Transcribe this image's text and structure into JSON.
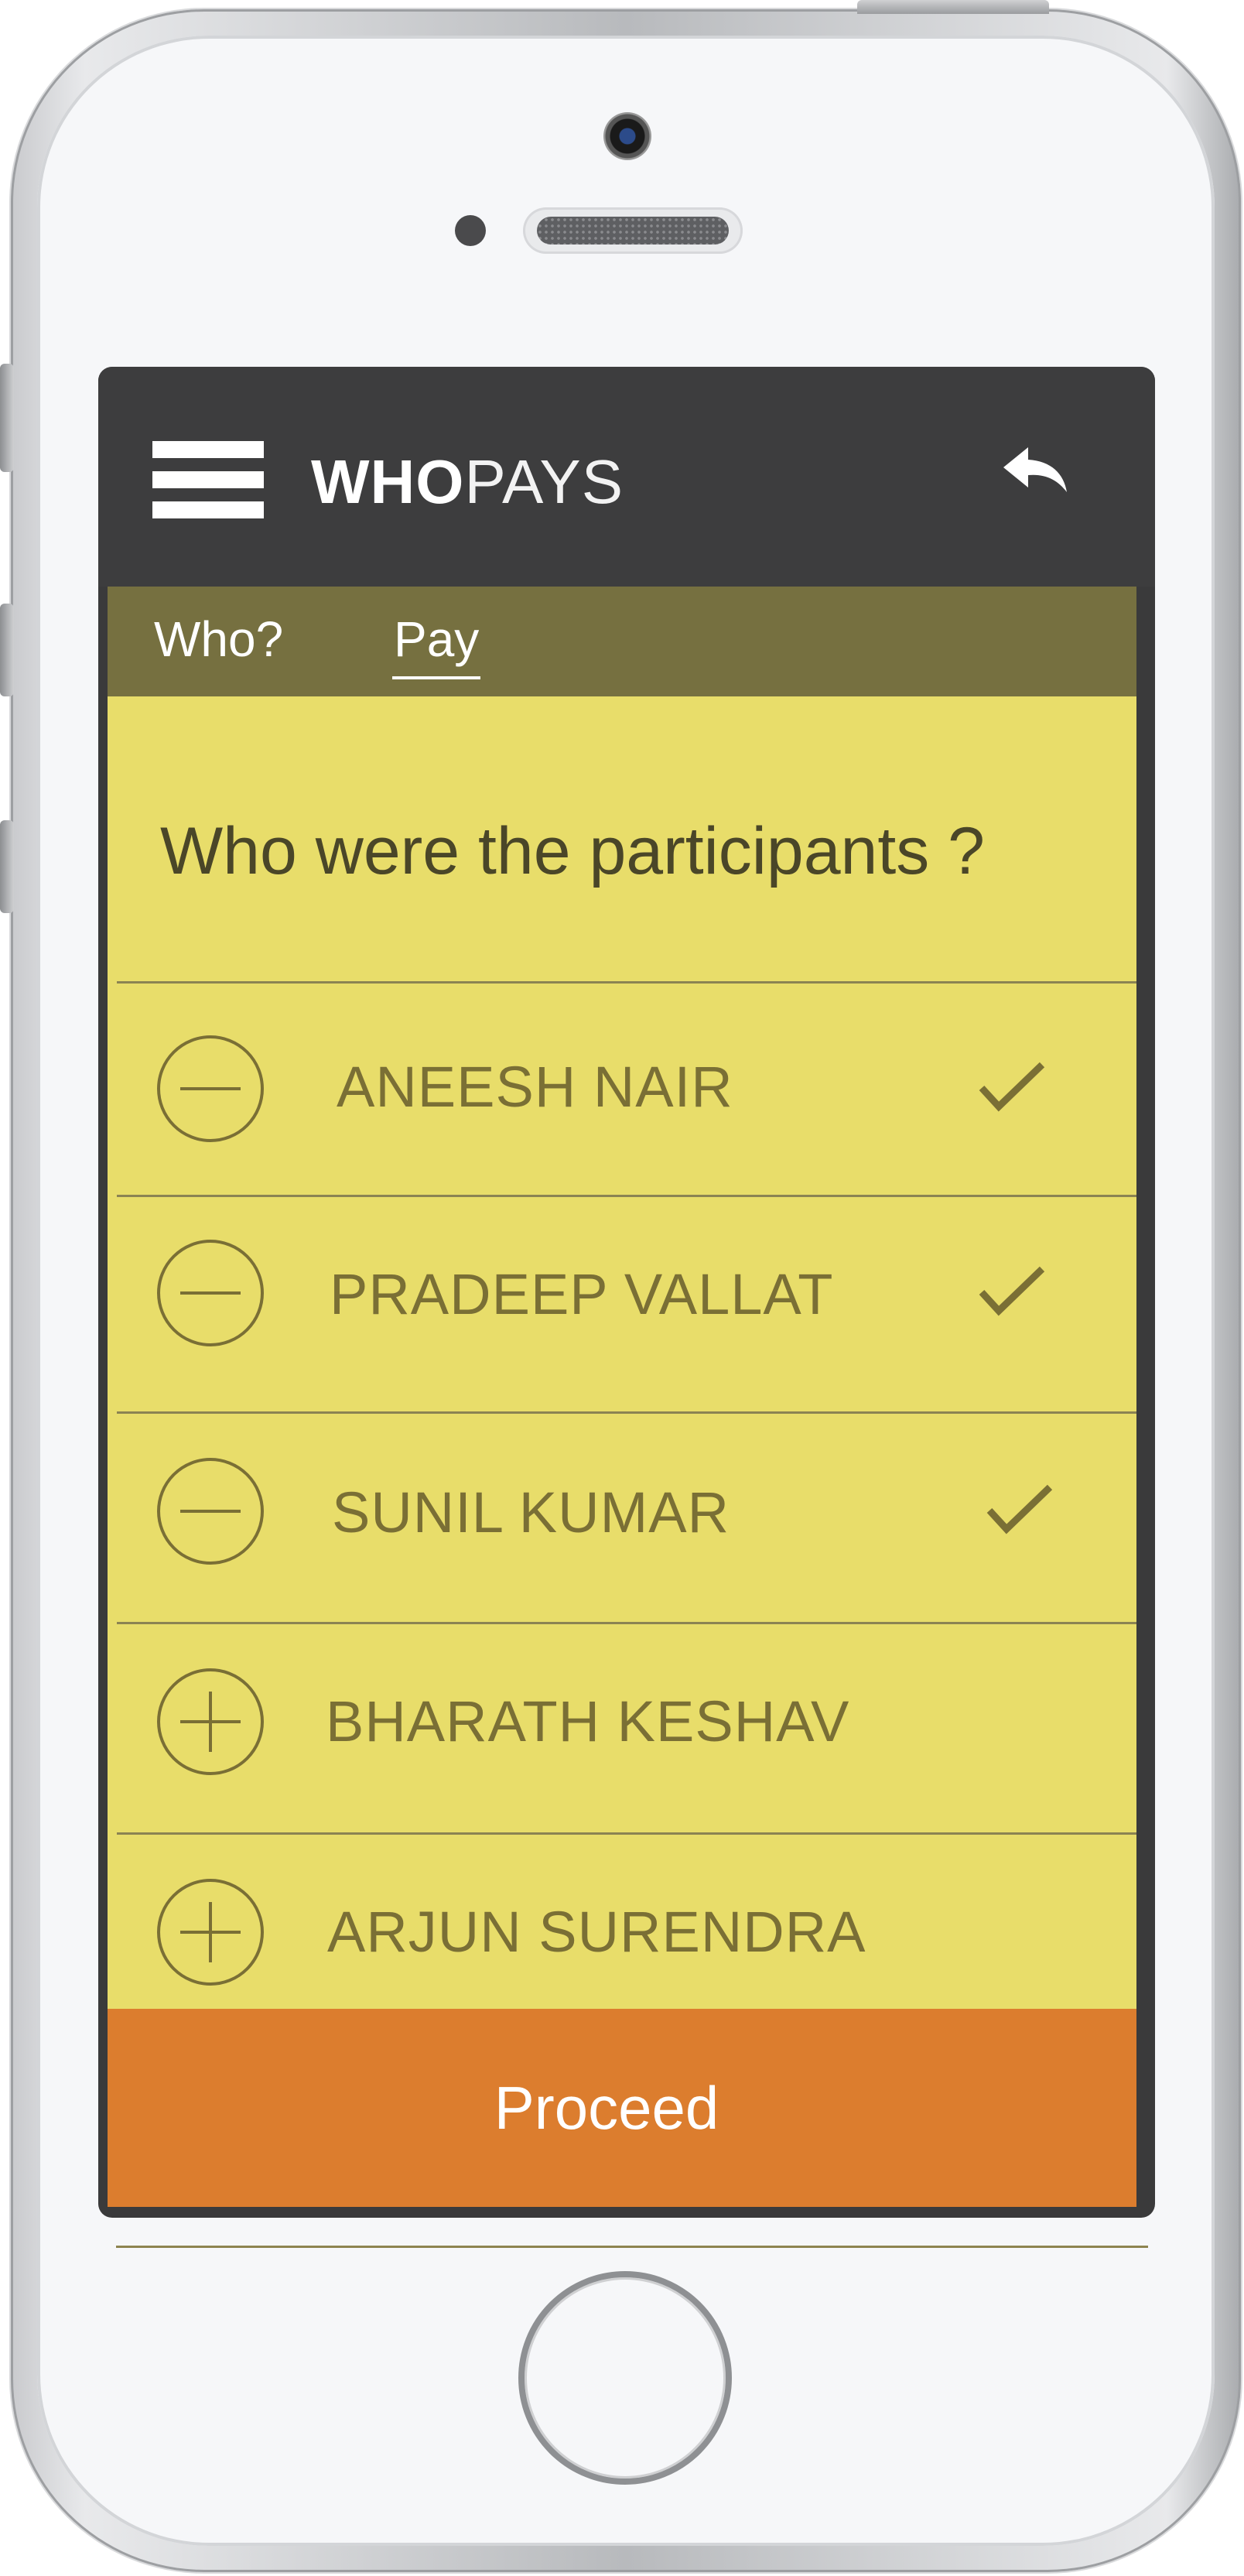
{
  "app": {
    "title_bold": "WHO",
    "title_light": "PAYS"
  },
  "header": {
    "menu_icon": "hamburger-icon",
    "back_icon": "reply-arrow-icon"
  },
  "tabs": [
    {
      "label": "Who?",
      "active": false
    },
    {
      "label": "Pay",
      "active": true
    }
  ],
  "question": "Who were the participants ?",
  "participants": [
    {
      "name": "ANEESH NAIR",
      "action_icon": "minus-circle-icon",
      "selected": true
    },
    {
      "name": "PRADEEP VALLAT",
      "action_icon": "minus-circle-icon",
      "selected": true
    },
    {
      "name": "SUNIL KUMAR",
      "action_icon": "minus-circle-icon",
      "selected": true
    },
    {
      "name": "BHARATH KESHAV",
      "action_icon": "plus-circle-icon",
      "selected": false
    },
    {
      "name": "ARJUN SURENDRA",
      "action_icon": "plus-circle-icon",
      "selected": false
    }
  ],
  "proceed_label": "Proceed",
  "colors": {
    "header": "#3d3d3e",
    "tabs_bar": "#767040",
    "content_bg": "#e8dd6a",
    "text_olive": "#7a6f35",
    "proceed": "#dc7d2e"
  }
}
